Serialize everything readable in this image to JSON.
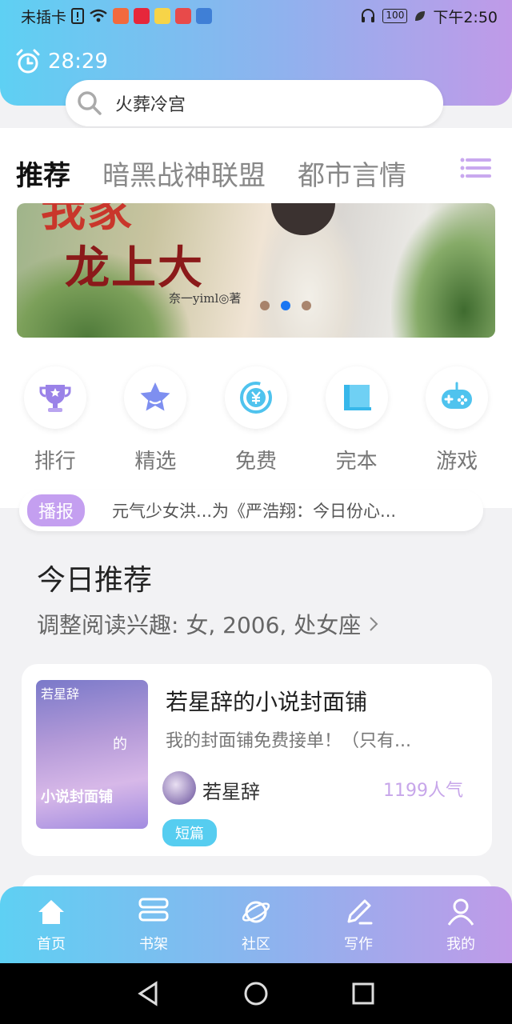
{
  "status_bar": {
    "carrier": "未插卡",
    "battery": "100",
    "time": "下午2:50"
  },
  "timer": {
    "value": "28:29"
  },
  "search": {
    "placeholder": "火葬冷宫"
  },
  "tabs": [
    {
      "label": "推荐",
      "active": true
    },
    {
      "label": "暗黑战神联盟",
      "active": false
    },
    {
      "label": "都市言情",
      "active": false
    }
  ],
  "banner": {
    "title_top": "我家",
    "title": "龙上大",
    "author": "奈一yiml◎著",
    "slide_count": 3,
    "active_slide": 2
  },
  "categories": [
    {
      "label": "排行",
      "icon": "trophy-icon"
    },
    {
      "label": "精选",
      "icon": "star-icon"
    },
    {
      "label": "免费",
      "icon": "free-icon"
    },
    {
      "label": "完本",
      "icon": "book-icon"
    },
    {
      "label": "游戏",
      "icon": "gamepad-icon"
    }
  ],
  "ticker": {
    "badge": "播报",
    "text": "元气少女洪...为《严浩翔：今日份心..."
  },
  "section": {
    "title": "今日推荐",
    "subtitle": "调整阅读兴趣: 女, 2006, 处女座"
  },
  "book": {
    "title": "若星辞的小说封面铺",
    "description": "我的封面铺免费接单！（只有...",
    "author": "若星辞",
    "popularity": "1199人气",
    "tag": "短篇",
    "cover_title": "若星辞",
    "cover_mid": "的",
    "cover_main": "小说封面铺"
  },
  "bottom_nav": [
    {
      "label": "首页",
      "icon": "home-icon"
    },
    {
      "label": "书架",
      "icon": "bookshelf-icon"
    },
    {
      "label": "社区",
      "icon": "planet-icon"
    },
    {
      "label": "写作",
      "icon": "pen-icon"
    },
    {
      "label": "我的",
      "icon": "user-icon"
    }
  ],
  "colors": {
    "gradient_start": "#5ed0f3",
    "gradient_end": "#c09ae8",
    "accent_purple": "#c49ff0",
    "tag_blue": "#56cdf0"
  }
}
